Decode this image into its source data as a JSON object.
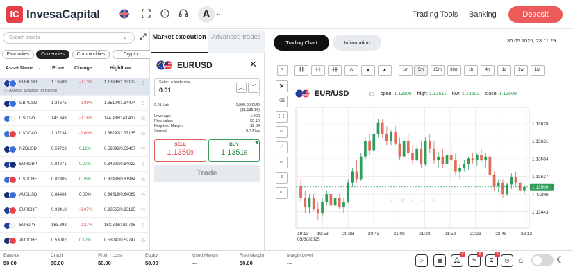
{
  "header": {
    "logo_mark": "IC",
    "brand": "InvesaCapital",
    "avatar_letter": "A",
    "nav": [
      "Trading Tools",
      "Banking"
    ],
    "deposit_label": "Deposit"
  },
  "assets_panel": {
    "search_placeholder": "Search assets",
    "categories": [
      "Favourites",
      "Currencies",
      "Commodities",
      "Cryptoc"
    ],
    "active_category": "Currencies",
    "columns": [
      "Asset Name",
      "Price",
      "Change",
      "High/Low"
    ],
    "available_note": "Asset is available for trading",
    "rows": [
      {
        "symbol": "EURUSD",
        "price": "1.13509",
        "change": "-0.13%",
        "highlow": "1.13896/1.13122",
        "flag_a": "#1f3f9a",
        "flag_b": "#3b6fd4",
        "trend": "neg"
      },
      {
        "symbol": "GBPUSD",
        "price": "1.34675",
        "change": "-0.09%",
        "highlow": "1.35104/1.34474",
        "flag_a": "#1a2f7a",
        "flag_b": "#3b6fd4",
        "trend": "neg"
      },
      {
        "symbol": "USDJPY",
        "price": "143.848",
        "change": "-0.16%",
        "highlow": "144.438/143.437",
        "flag_a": "#3b6fd4",
        "flag_b": "#f2f2f2",
        "trend": "neg"
      },
      {
        "symbol": "USDCAD",
        "price": "1.37234",
        "change": "-0.60%",
        "highlow": "1.38292/1.37135",
        "flag_a": "#3b6fd4",
        "flag_b": "#e8404a",
        "trend": "neg"
      },
      {
        "symbol": "NZDUSD",
        "price": "0.59723",
        "change": "0.12%",
        "highlow": "0.59892/0.59467",
        "flag_a": "#1a2f7a",
        "flag_b": "#3b6fd4",
        "trend": "pos"
      },
      {
        "symbol": "EURGBP",
        "price": "0.84271",
        "change": "0.07%",
        "highlow": "0.84390/0.84022",
        "flag_a": "#1f3f9a",
        "flag_b": "#1a2f7a",
        "trend": "pos"
      },
      {
        "symbol": "USDCHF",
        "price": "0.82305",
        "change": "0.05%",
        "highlow": "0.82488/0.81984",
        "flag_a": "#3b6fd4",
        "flag_b": "#e8404a",
        "trend": "pos"
      },
      {
        "symbol": "AUDUSD",
        "price": "0.64404",
        "change": "0.00%",
        "highlow": "0.64518/0.64069",
        "flag_a": "#1a2f7a",
        "flag_b": "#3b6fd4",
        "trend": "none"
      },
      {
        "symbol": "EURCHF",
        "price": "0.93418",
        "change": "-0.07%",
        "highlow": "0.93565/0.93195",
        "flag_a": "#1f3f9a",
        "flag_b": "#e8404a",
        "trend": "neg"
      },
      {
        "symbol": "EURJPY",
        "price": "163.392",
        "change": "-0.27%",
        "highlow": "163.893/162.796",
        "flag_a": "#1f3f9a",
        "flag_b": "#f2f2f2",
        "trend": "neg"
      },
      {
        "symbol": "AUDCHF",
        "price": "0.53002",
        "change": "0.12%",
        "highlow": "0.53040/0.52747",
        "flag_a": "#1a2f7a",
        "flag_b": "#e8404a",
        "trend": "pos"
      }
    ]
  },
  "order_panel": {
    "tab_market": "Market execution",
    "tab_advanced": "Advanced trades",
    "symbol": "EURUSD",
    "trade_size_label": "Select a trade size",
    "trade_size_value": "0.01",
    "lot_label": "0.01 Lot:",
    "lot_value": "1,000.00 EUR",
    "lot_value2": "($1,135.16)",
    "details": [
      {
        "label": "Leverage:",
        "value": "1:400"
      },
      {
        "label": "Pips Value:",
        "value": "$0.10"
      },
      {
        "label": "Required Margin:",
        "value": "$2.84"
      },
      {
        "label": "Spread:",
        "value": "0.7 Pips"
      }
    ],
    "sell_label": "SELL",
    "sell_price_main": "1.1350",
    "sell_price_pip": "9",
    "buy_label": "BUY",
    "buy_price_main": "1.1351",
    "buy_price_pip": "6",
    "trade_button": "Trade"
  },
  "chart_panel": {
    "tab_chart": "Trading Chart",
    "tab_info": "Information",
    "datetime": "30.05.2025, 23:11:29",
    "timeframes": [
      "1m",
      "5m",
      "15m",
      "30m",
      "1h",
      "4h",
      "1d",
      "1w",
      "1M"
    ],
    "active_timeframe": "5m"
  },
  "chart_data": {
    "type": "candlestick",
    "title": "EUR/USD",
    "ohlc_labels": {
      "open": "open:",
      "high": "high:",
      "low": "low:",
      "close": "close:"
    },
    "ohlc_values": {
      "open": "1.13506",
      "high": "1.13511",
      "low": "1.13502",
      "close": "1.13509"
    },
    "current_price_label": "1.13509",
    "ylim": [
      1.134,
      1.1372
    ],
    "y_ticks": [
      "1.13678",
      "1.13631",
      "1.13584",
      "1.13537",
      "1.13490",
      "1.13443"
    ],
    "x_ticks": [
      "19:13",
      "19:53",
      "20:18",
      "20:43",
      "21:08",
      "21:33",
      "21:58",
      "22:23",
      "22:48",
      "23:13"
    ],
    "x_date": "05/30/2025",
    "candles": [
      [
        1.1351,
        1.1353,
        1.1347,
        1.1348
      ],
      [
        1.1348,
        1.135,
        1.1344,
        1.13455
      ],
      [
        1.13455,
        1.1349,
        1.1344,
        1.1348
      ],
      [
        1.1348,
        1.1349,
        1.13445,
        1.1345
      ],
      [
        1.1345,
        1.1347,
        1.1342,
        1.1344
      ],
      [
        1.1344,
        1.1348,
        1.1343,
        1.1347
      ],
      [
        1.1347,
        1.135,
        1.1346,
        1.1349
      ],
      [
        1.1349,
        1.135,
        1.13455,
        1.1346
      ],
      [
        1.1346,
        1.1349,
        1.13445,
        1.1348
      ],
      [
        1.1348,
        1.1349,
        1.1345,
        1.13455
      ],
      [
        1.13455,
        1.1348,
        1.1344,
        1.1347
      ],
      [
        1.1347,
        1.1353,
        1.13465,
        1.1352
      ],
      [
        1.1352,
        1.1356,
        1.1351,
        1.1355
      ],
      [
        1.1355,
        1.1358,
        1.1352,
        1.1353
      ],
      [
        1.1353,
        1.136,
        1.13525,
        1.1359
      ],
      [
        1.1359,
        1.1364,
        1.1358,
        1.1363
      ],
      [
        1.1363,
        1.1365,
        1.13595,
        1.13605
      ],
      [
        1.13605,
        1.1366,
        1.136,
        1.1365
      ],
      [
        1.1365,
        1.1369,
        1.1364,
        1.1368
      ],
      [
        1.1368,
        1.1369,
        1.1364,
        1.1365
      ],
      [
        1.1365,
        1.1367,
        1.1362,
        1.1363
      ],
      [
        1.1363,
        1.1366,
        1.1362,
        1.13655
      ],
      [
        1.13655,
        1.1367,
        1.1362,
        1.13625
      ],
      [
        1.13625,
        1.1364,
        1.1358,
        1.1359
      ],
      [
        1.1359,
        1.1364,
        1.13585,
        1.1363
      ],
      [
        1.1363,
        1.1365,
        1.1359,
        1.136
      ],
      [
        1.136,
        1.1362,
        1.1357,
        1.1358
      ],
      [
        1.1358,
        1.1362,
        1.13575,
        1.1361
      ],
      [
        1.1361,
        1.1363,
        1.1356,
        1.1357
      ],
      [
        1.1357,
        1.1364,
        1.13565,
        1.1363
      ],
      [
        1.1363,
        1.1365,
        1.136,
        1.1361
      ],
      [
        1.1361,
        1.1363,
        1.1357,
        1.1358
      ],
      [
        1.1358,
        1.136,
        1.1356,
        1.1359
      ],
      [
        1.1359,
        1.1361,
        1.1356,
        1.1357
      ],
      [
        1.1357,
        1.136,
        1.13555,
        1.13595
      ],
      [
        1.13595,
        1.1362,
        1.1357,
        1.1358
      ],
      [
        1.1358,
        1.136,
        1.1354,
        1.1355
      ],
      [
        1.1355,
        1.1357,
        1.1353,
        1.1356
      ],
      [
        1.1356,
        1.1358,
        1.1355,
        1.1357
      ],
      [
        1.1357,
        1.1359,
        1.13555,
        1.13585
      ],
      [
        1.13585,
        1.136,
        1.1357,
        1.1358
      ],
      [
        1.1358,
        1.136,
        1.13565,
        1.13595
      ],
      [
        1.13595,
        1.1361,
        1.13575,
        1.1358
      ],
      [
        1.1358,
        1.136,
        1.1356,
        1.1359
      ],
      [
        1.1359,
        1.136,
        1.1353,
        1.1354
      ],
      [
        1.1354,
        1.1355,
        1.135,
        1.1351
      ],
      [
        1.1351,
        1.1353,
        1.13495,
        1.1352
      ],
      [
        1.1352,
        1.1353,
        1.1348,
        1.1349
      ],
      [
        1.1349,
        1.1352,
        1.13485,
        1.13515
      ],
      [
        1.13515,
        1.13545,
        1.13505,
        1.13535
      ],
      [
        1.13535,
        1.1355,
        1.1351,
        1.1352
      ],
      [
        1.1352,
        1.1353,
        1.13495,
        1.135
      ],
      [
        1.135,
        1.13515,
        1.1349,
        1.13509
      ]
    ]
  },
  "footer": {
    "items": [
      {
        "label": "Balance",
        "value": "$0.00"
      },
      {
        "label": "Credit",
        "value": "$0.00"
      },
      {
        "label": "Profit / Loss",
        "value": "$0.00"
      },
      {
        "label": "Equity",
        "value": "$0.00"
      },
      {
        "label": "Used Margin",
        "value": "---"
      },
      {
        "label": "Free Margin",
        "value": "$0.00"
      },
      {
        "label": "Margin Level",
        "value": "---"
      }
    ],
    "badges": [
      "0",
      "0",
      "0"
    ]
  },
  "colors": {
    "up": "#2e9d5c",
    "down": "#e06c5a",
    "accent": "#ec5a5a"
  }
}
